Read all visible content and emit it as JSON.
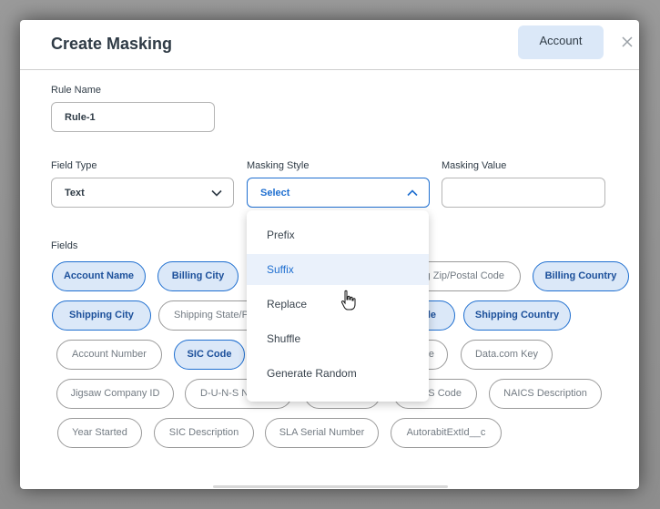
{
  "modal": {
    "title": "Create Masking",
    "account_button": "Account"
  },
  "rule_name": {
    "label": "Rule Name",
    "value": "Rule-1"
  },
  "field_type": {
    "label": "Field Type",
    "value": "Text"
  },
  "masking_style": {
    "label": "Masking Style",
    "value": "Select"
  },
  "masking_value": {
    "label": "Masking Value",
    "value": ""
  },
  "fields_label": "Fields",
  "chips": [
    {
      "label": "Account Name",
      "selected": true
    },
    {
      "label": "Billing City",
      "selected": true
    },
    {
      "label": "g Zip/Postal Code",
      "selected": false
    },
    {
      "label": "Billing Country",
      "selected": true
    },
    {
      "label": "Shipping City",
      "selected": true
    },
    {
      "label": "Shipping State/P",
      "selected": false
    },
    {
      "label": "le",
      "selected": true
    },
    {
      "label": "Shipping Country",
      "selected": true
    },
    {
      "label": "Account Number",
      "selected": false
    },
    {
      "label": "SIC Code",
      "selected": true
    },
    {
      "label": "e",
      "selected": false
    },
    {
      "label": "Data.com Key",
      "selected": false
    },
    {
      "label": "Jigsaw Company ID",
      "selected": false
    },
    {
      "label": "D-U-N-S N",
      "selected": false
    },
    {
      "label": "",
      "selected": false
    },
    {
      "label": "CS Code",
      "selected": false
    },
    {
      "label": "NAICS Description",
      "selected": false
    },
    {
      "label": "Year Started",
      "selected": false
    },
    {
      "label": "SIC Description",
      "selected": false
    },
    {
      "label": "SLA Serial Number",
      "selected": false
    },
    {
      "label": "AutorabitExtId__c",
      "selected": false
    }
  ],
  "dropdown_options": [
    "Prefix",
    "Suffix",
    "Replace",
    "Shuffle",
    "Generate Random"
  ],
  "hovered_option": "Suffix",
  "colors": {
    "accent": "#1f6fd0",
    "chip_selected_bg": "#dbe8f8",
    "text": "#2f3b46"
  }
}
